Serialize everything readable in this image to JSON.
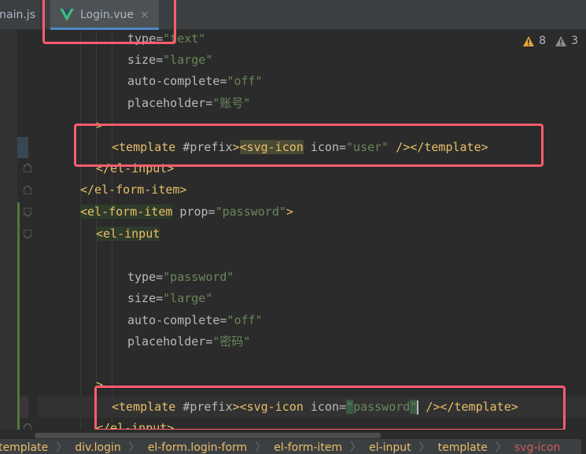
{
  "tabs": {
    "main_label": "nain.js",
    "active_label": "Login.vue",
    "active_icon": "vue-icon",
    "close_glyph": "×"
  },
  "inspections": {
    "warnings_count": "8",
    "weak_warnings_count": "3",
    "warning_color": "#e8a33d"
  },
  "code": {
    "l1": {
      "attr": "type=",
      "val": "\"text\""
    },
    "l2": {
      "attr": "size=",
      "val": "\"large\""
    },
    "l3": {
      "attr": "auto-complete=",
      "val": "\"off\""
    },
    "l4": {
      "attr": "placeholder=",
      "val": "\"账号\""
    },
    "l5": {
      "text": ">"
    },
    "l6": {
      "open": "<template ",
      "hash": "#prefix",
      "gt": ">",
      "svg_open": "<svg-icon",
      "attr": " icon=",
      "val": "\"user\"",
      "close": " /></template>"
    },
    "l7": {
      "text": "</el-input>"
    },
    "l8": {
      "text": "</el-form-item>"
    },
    "l9": {
      "tag": "<el-form-item",
      "attr": " prop=",
      "val": "\"password\"",
      "gt": ">"
    },
    "l10": {
      "text": "<el-input"
    },
    "l11": {
      "attr": "type=",
      "val": "\"password\""
    },
    "l12": {
      "attr": "size=",
      "val": "\"large\""
    },
    "l13": {
      "attr": "auto-complete=",
      "val": "\"off\""
    },
    "l14": {
      "attr": "placeholder=",
      "val": "\"密码\""
    },
    "l15": {
      "text": ">"
    },
    "l16": {
      "open": "<template ",
      "hash": "#prefix",
      "gt": ">",
      "svg_open": "<svg-icon",
      "attr": " icon=",
      "q1": "\"",
      "val": "password",
      "q2": "\"",
      "close": " /></template>"
    },
    "l17": {
      "text": "</el-input>"
    }
  },
  "breadcrumb": [
    "template",
    "div.login",
    "el-form.login-form",
    "el-form-item",
    "el-input",
    "template",
    "svg-icon"
  ],
  "breadcrumb_separator": "〉"
}
